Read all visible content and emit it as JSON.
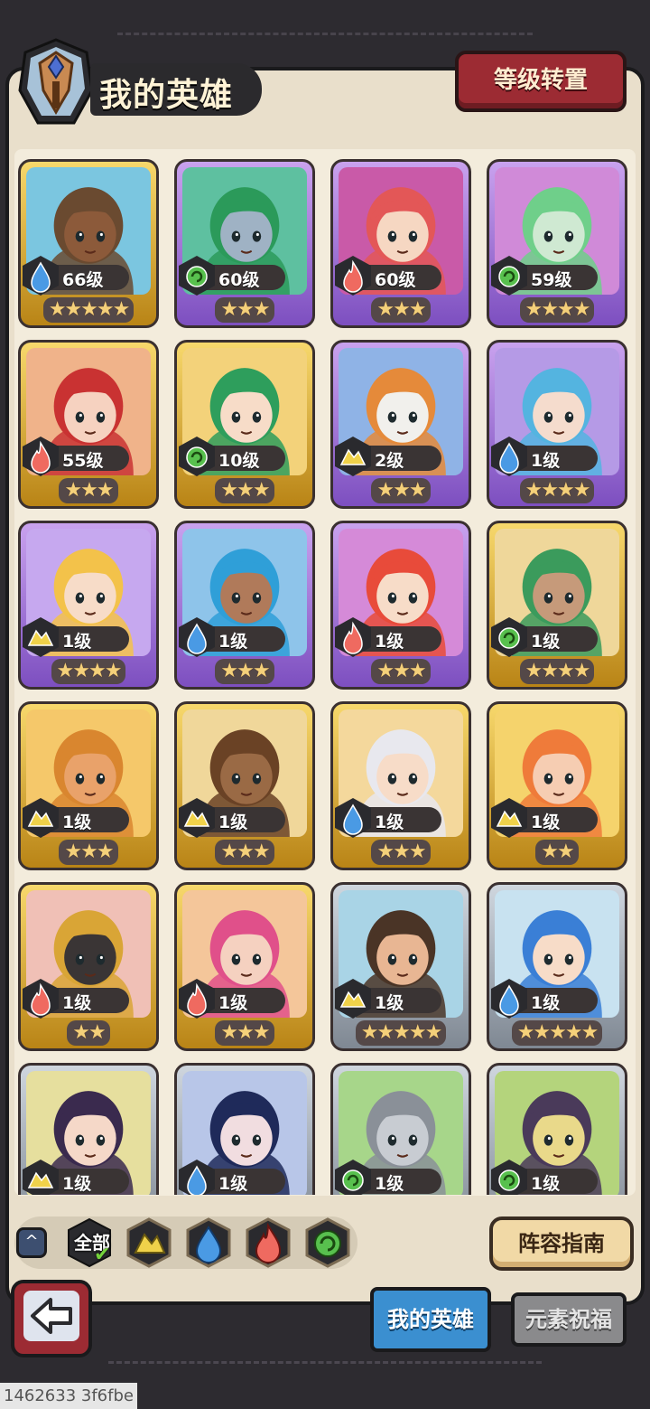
{
  "header": {
    "title": "我的英雄",
    "reset_button": "等级转置"
  },
  "colors": {
    "gold": "#f2c75c",
    "purple": "#b48ae6",
    "silver": "#b7c0c9",
    "fire": "#e85a55",
    "water": "#3e8ed8",
    "wind": "#47b04a",
    "earth": "#e6c73a"
  },
  "heroes": [
    {
      "level": "66级",
      "stars": "★★★★★",
      "element": "water",
      "frame": "gold",
      "tint": "#7bc6e0",
      "skin": "#8c5a3a",
      "hair": "#6a4a30"
    },
    {
      "level": "60级",
      "stars": "★★★",
      "element": "wind",
      "frame": "purple",
      "tint": "#5ec0a0",
      "skin": "#9fb2c4",
      "hair": "#2b9a5a"
    },
    {
      "level": "60级",
      "stars": "★★★",
      "element": "fire",
      "frame": "purple",
      "tint": "#c95aa8",
      "skin": "#f6d7c2",
      "hair": "#e35757"
    },
    {
      "level": "59级",
      "stars": "★★★★",
      "element": "wind",
      "frame": "purple",
      "tint": "#d08ad8",
      "skin": "#cfe9d2",
      "hair": "#6fcf8a"
    },
    {
      "level": "55级",
      "stars": "★★★",
      "element": "fire",
      "frame": "gold",
      "tint": "#f0b38a",
      "skin": "#f6d2c0",
      "hair": "#c93232"
    },
    {
      "level": "10级",
      "stars": "★★★",
      "element": "wind",
      "frame": "gold",
      "tint": "#f3d27a",
      "skin": "#f7dcc8",
      "hair": "#2e9e5c"
    },
    {
      "level": "2级",
      "stars": "★★★",
      "element": "earth",
      "frame": "purple",
      "tint": "#8fb3e6",
      "skin": "#f1f0ec",
      "hair": "#e58a3a"
    },
    {
      "level": "1级",
      "stars": "★★★★",
      "element": "water",
      "frame": "purple",
      "tint": "#b59ae6",
      "skin": "#f5dccd",
      "hair": "#54b4e0"
    },
    {
      "level": "1级",
      "stars": "★★★★",
      "element": "earth",
      "frame": "purple",
      "tint": "#c6a8ef",
      "skin": "#f7dcc8",
      "hair": "#f3c24a"
    },
    {
      "level": "1级",
      "stars": "★★★",
      "element": "water",
      "frame": "purple",
      "tint": "#8ec4ea",
      "skin": "#b07a5a",
      "hair": "#2f9fd8"
    },
    {
      "level": "1级",
      "stars": "★★★",
      "element": "fire",
      "frame": "purple",
      "tint": "#d58ad8",
      "skin": "#f7dcc8",
      "hair": "#e84b3a"
    },
    {
      "level": "1级",
      "stars": "★★★★",
      "element": "wind",
      "frame": "gold",
      "tint": "#efd79a",
      "skin": "#c69a7a",
      "hair": "#3b9b5c"
    },
    {
      "level": "1级",
      "stars": "★★★",
      "element": "earth",
      "frame": "gold",
      "tint": "#f5c86a",
      "skin": "#e9a26a",
      "hair": "#d9862f"
    },
    {
      "level": "1级",
      "stars": "★★★",
      "element": "earth",
      "frame": "gold",
      "tint": "#f0d79a",
      "skin": "#9a6a45",
      "hair": "#6a4225"
    },
    {
      "level": "1级",
      "stars": "★★★",
      "element": "water",
      "frame": "gold",
      "tint": "#f4d89c",
      "skin": "#f7dcc8",
      "hair": "#e8e8ee"
    },
    {
      "level": "1级",
      "stars": "★★",
      "element": "earth",
      "frame": "gold",
      "tint": "#f5d36c",
      "skin": "#f6cdb2",
      "hair": "#ef7b3a"
    },
    {
      "level": "1级",
      "stars": "★★",
      "element": "fire",
      "frame": "gold",
      "tint": "#f0c0b6",
      "skin": "#3a3535",
      "hair": "#d9a536"
    },
    {
      "level": "1级",
      "stars": "★★★",
      "element": "fire",
      "frame": "gold",
      "tint": "#f4c69a",
      "skin": "#f5d1c0",
      "hair": "#e0508a"
    },
    {
      "level": "1级",
      "stars": "★★★★★",
      "element": "earth",
      "frame": "silver",
      "tint": "#a9d4e6",
      "skin": "#e8b693",
      "hair": "#4a3426"
    },
    {
      "level": "1级",
      "stars": "★★★★★",
      "element": "water",
      "frame": "silver",
      "tint": "#c8e2f0",
      "skin": "#f7dcc8",
      "hair": "#3a7fd6"
    },
    {
      "level": "1级",
      "stars": "",
      "element": "earth",
      "frame": "silver",
      "tint": "#e6df9e",
      "skin": "#f5d8c8",
      "hair": "#3a2a4e"
    },
    {
      "level": "1级",
      "stars": "",
      "element": "water",
      "frame": "silver",
      "tint": "#b8c6e8",
      "skin": "#f1dde0",
      "hair": "#1f2a5a"
    },
    {
      "level": "1级",
      "stars": "",
      "element": "wind",
      "frame": "silver",
      "tint": "#a7d68a",
      "skin": "#c8ccd2",
      "hair": "#8a9098"
    },
    {
      "level": "1级",
      "stars": "",
      "element": "wind",
      "frame": "silver",
      "tint": "#b4d47c",
      "skin": "#e9d98a",
      "hair": "#4a3a5a"
    }
  ],
  "filters": {
    "all_label": "全部",
    "options": [
      "earth",
      "water",
      "fire",
      "wind"
    ]
  },
  "guide_button": "阵容指南",
  "tabs": {
    "my_heroes": "我的英雄",
    "blessing": "元素祝福"
  },
  "footer_id": "1462633 3f6fbe"
}
